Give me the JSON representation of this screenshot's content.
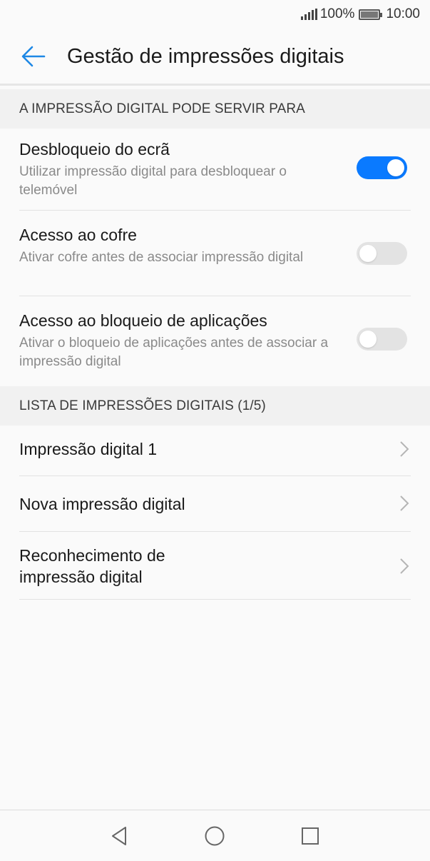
{
  "status_bar": {
    "battery_pct": "100%",
    "time": "10:00",
    "icons": [
      "signal-icon",
      "battery-icon"
    ]
  },
  "app_bar": {
    "title": "Gestão de impressões digitais",
    "back_icon": "arrow-left-icon",
    "accent_color": "#1e88e5"
  },
  "section_usage": {
    "header": "A IMPRESSÃO DIGITAL PODE SERVIR PARA",
    "items": [
      {
        "title": "Desbloqueio do ecrã",
        "subtitle": "Utilizar impressão digital para desbloquear o telemóvel",
        "enabled": true
      },
      {
        "title": "Acesso ao cofre",
        "subtitle": "Ativar cofre antes de associar impressão digital",
        "enabled": false
      },
      {
        "title": "Acesso ao bloqueio de aplicações",
        "subtitle": "Ativar o bloqueio de aplicações antes de associar a impressão digital",
        "enabled": false
      }
    ]
  },
  "section_list": {
    "header": "LISTA DE IMPRESSÕES DIGITAIS (1/5)",
    "items": [
      {
        "label": "Impressão digital 1"
      },
      {
        "label": "Nova impressão digital"
      },
      {
        "label": "Reconhecimento de impressão digital"
      }
    ]
  },
  "colors": {
    "switch_on": "#0a7aff",
    "switch_off": "#e3e3e3",
    "subtitle_text": "#8a8a8a"
  },
  "bottom_nav": [
    "back-triangle-icon",
    "home-circle-icon",
    "recents-square-icon"
  ]
}
